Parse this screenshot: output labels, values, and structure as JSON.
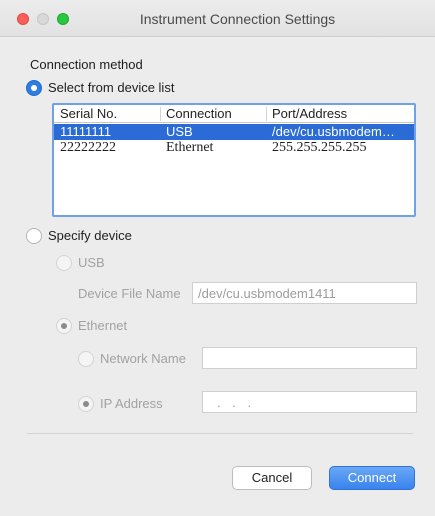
{
  "window": {
    "title": "Instrument Connection Settings"
  },
  "connection_method": {
    "label": "Connection method",
    "select_from_list": {
      "label": "Select from device list",
      "selected": true
    },
    "device_list": {
      "columns": [
        "Serial No.",
        "Connection",
        "Port/Address"
      ],
      "rows": [
        {
          "serial": "11111111",
          "connection": "USB",
          "port": "/dev/cu.usbmodem…",
          "selected": true
        },
        {
          "serial": "22222222",
          "connection": "Ethernet",
          "port": "255.255.255.255",
          "selected": false
        }
      ]
    },
    "specify_device": {
      "label": "Specify device",
      "selected": false,
      "usb": {
        "label": "USB",
        "device_file_label": "Device File Name",
        "device_file_value": "/dev/cu.usbmodem1411"
      },
      "ethernet": {
        "label": "Ethernet",
        "network_name_label": "Network Name",
        "network_name_value": "",
        "ip_address_label": "IP Address",
        "ip_address_value": ". . ."
      }
    }
  },
  "buttons": {
    "cancel": "Cancel",
    "connect": "Connect"
  },
  "colors": {
    "accent": "#2f7de1",
    "selection": "#2a6bd6",
    "close": "#fc5f57",
    "zoom": "#28c840"
  }
}
